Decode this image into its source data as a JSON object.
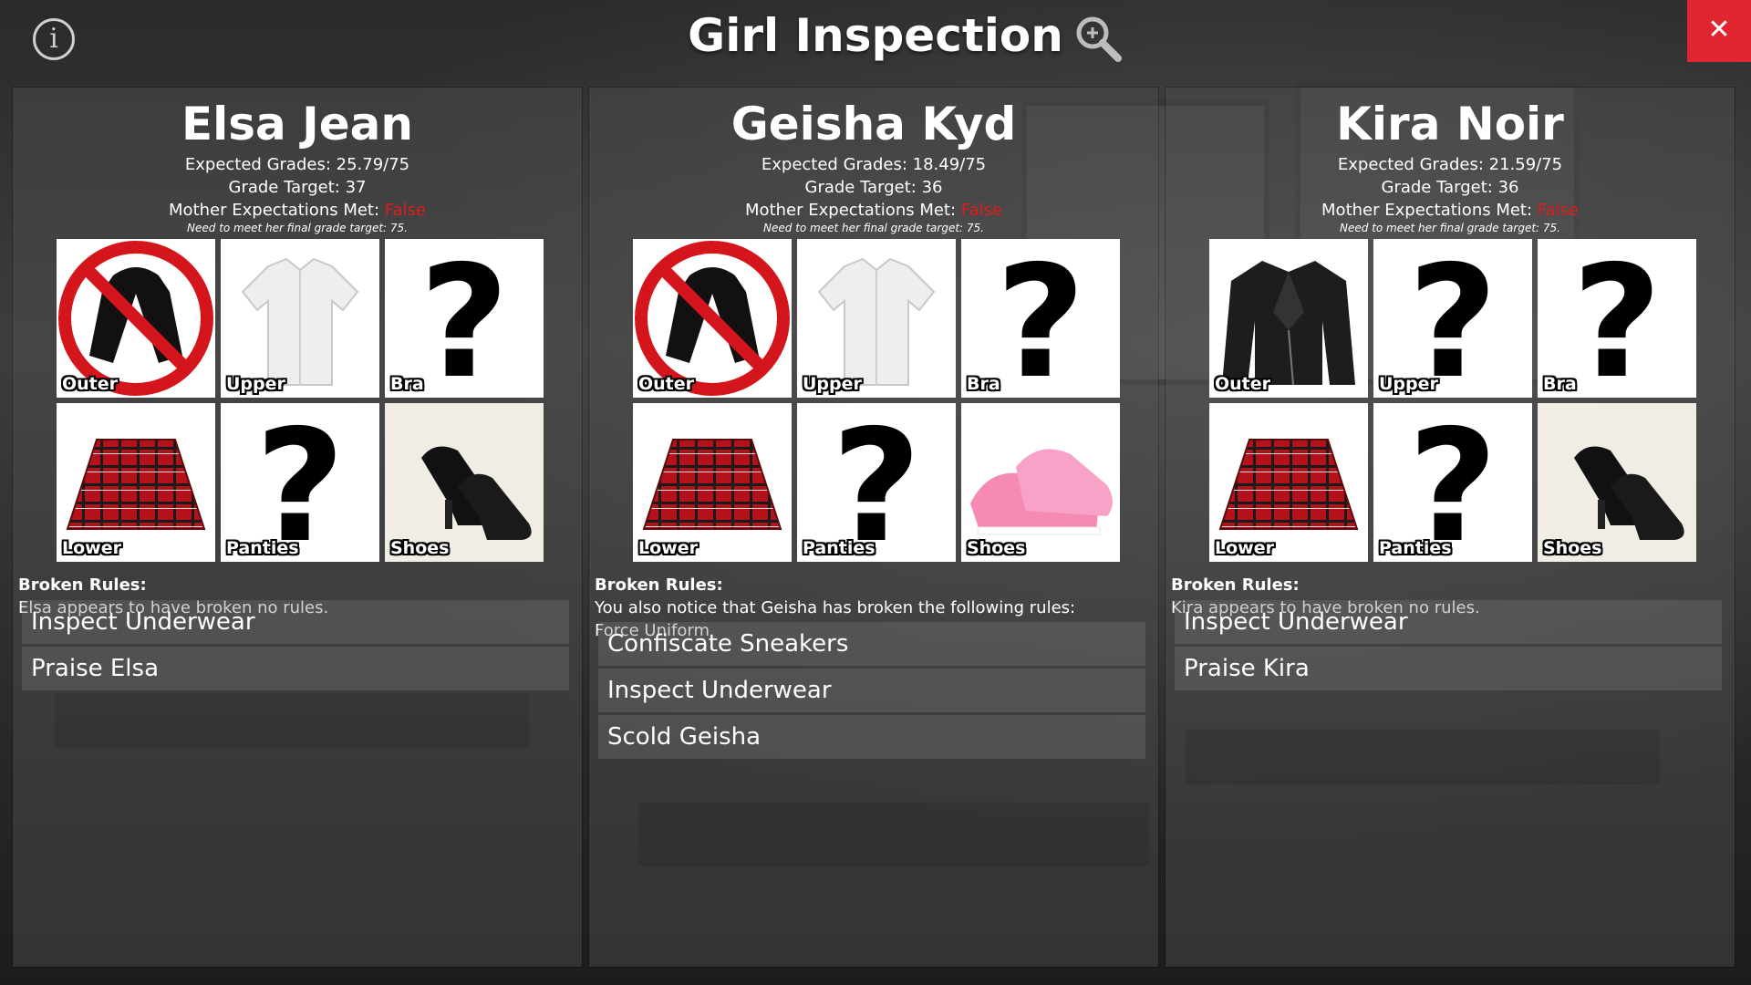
{
  "header": {
    "title": "Girl Inspection",
    "info_label": "i",
    "close_label": "✕"
  },
  "slot_labels": [
    "Outer",
    "Upper",
    "Bra",
    "Lower",
    "Panties",
    "Shoes"
  ],
  "labels": {
    "expected_prefix": "Expected Grades: ",
    "target_prefix": "Grade Target: ",
    "mother_prefix": "Mother Expectations Met: ",
    "broken_rules": "Broken Rules:"
  },
  "girls": [
    {
      "name": "Elsa Jean",
      "expected": "25.79/75",
      "target": "37",
      "mother": "False",
      "note": "Need to meet her final grade target: 75.",
      "slots": [
        "no-outer-icon",
        "white-shirt-icon",
        "question-icon",
        "plaid-skirt-icon",
        "question-icon",
        "black-shoes-icon"
      ],
      "rules_text": "Elsa appears to have broken no rules.",
      "rules_extra": "",
      "actions": [
        "Inspect Underwear",
        "Praise Elsa"
      ]
    },
    {
      "name": "Geisha Kyd",
      "expected": "18.49/75",
      "target": "36",
      "mother": "False",
      "note": "Need to meet her final grade target: 75.",
      "slots": [
        "no-outer-icon",
        "white-shirt-icon",
        "question-icon",
        "plaid-skirt-icon",
        "question-icon",
        "pink-sneakers-icon"
      ],
      "rules_text": "You also notice that Geisha has broken the following rules:",
      "rules_extra": "Force Uniform",
      "actions": [
        "Confiscate Sneakers",
        "Inspect Underwear",
        "Scold Geisha"
      ]
    },
    {
      "name": "Kira Noir",
      "expected": "21.59/75",
      "target": "36",
      "mother": "False",
      "note": "Need to meet her final grade target: 75.",
      "slots": [
        "leather-jacket-icon",
        "question-icon",
        "question-icon",
        "plaid-skirt-icon",
        "question-icon",
        "black-shoes-icon"
      ],
      "rules_text": "Kira appears to have broken no rules.",
      "rules_extra": "",
      "actions": [
        "Inspect Underwear",
        "Praise Kira"
      ]
    }
  ]
}
